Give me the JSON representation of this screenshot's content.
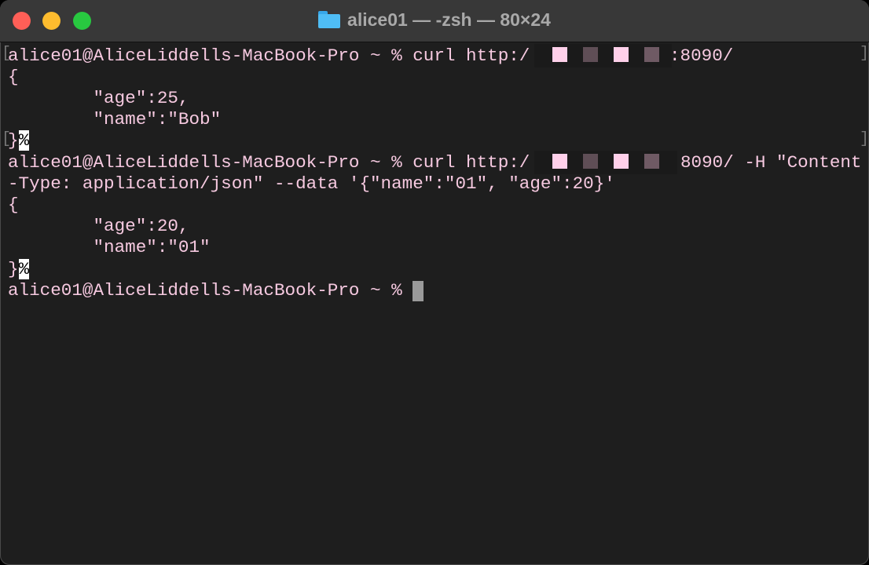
{
  "window": {
    "title": "alice01 — -zsh — 80×24",
    "folder_icon": "folder-icon",
    "traffic_lights": {
      "close": "#fe5f57",
      "minimize": "#febc2e",
      "zoom": "#28c840"
    }
  },
  "terminal": {
    "text_color": "#f6c9e0",
    "background": "#1e1e1e",
    "lines": [
      {
        "text": "alice01@AliceLiddells-MacBook-Pro ~ % curl http:/",
        "tail": ":8090/"
      },
      {
        "text": "{"
      },
      {
        "text": "        \"age\":25,"
      },
      {
        "text": "        \"name\":\"Bob\""
      },
      {
        "text": "}",
        "marker": "%"
      },
      {
        "text": "alice01@AliceLiddells-MacBook-Pro ~ % curl http:/",
        "tail": "8090/ -H \"Content"
      },
      {
        "text": "-Type: application/json\" --data '{\"name\":\"01\", \"age\":20}'"
      },
      {
        "text": "{"
      },
      {
        "text": "        \"age\":20,"
      },
      {
        "text": "        \"name\":\"01\""
      },
      {
        "text": "}",
        "marker": "%"
      },
      {
        "text": "alice01@AliceLiddells-MacBook-Pro ~ % "
      }
    ],
    "mark_open": "[",
    "mark_close": "]"
  }
}
